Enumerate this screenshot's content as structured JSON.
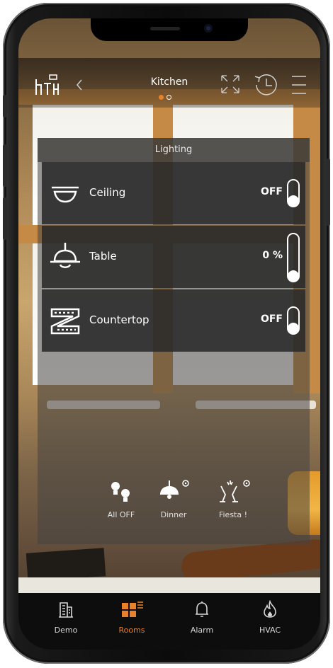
{
  "header": {
    "logo_text": "HTH",
    "room_title": "Kitchen",
    "page_dots": 2,
    "active_dot": 0
  },
  "panel": {
    "title": "Lighting",
    "rows": [
      {
        "label": "Ceiling",
        "value": "OFF",
        "icon": "ceiling-lamp-icon",
        "level": 0
      },
      {
        "label": "Table",
        "value": "0 %",
        "icon": "pendant-lamp-icon",
        "level": 0
      },
      {
        "label": "Countertop",
        "value": "OFF",
        "icon": "led-strip-icon",
        "level": 0
      }
    ],
    "scenes": [
      {
        "label": "All OFF",
        "icon": "bulbs-off-icon"
      },
      {
        "label": "Dinner",
        "icon": "pendant-lamp-icon",
        "settings_icon": "gear-icon"
      },
      {
        "label": "Fiesta !",
        "icon": "champagne-glasses-icon",
        "settings_icon": "gear-icon"
      }
    ]
  },
  "nav": {
    "items": [
      {
        "label": "Demo",
        "icon": "building-icon",
        "active": false
      },
      {
        "label": "Rooms",
        "icon": "rooms-icon",
        "active": true
      },
      {
        "label": "Alarm",
        "icon": "bell-icon",
        "active": false
      },
      {
        "label": "HVAC",
        "icon": "flame-icon",
        "active": false
      }
    ]
  },
  "colors": {
    "accent": "#e8812b",
    "text": "#ffffff",
    "panel_row": "#282828",
    "nav_bg": "#0d0d0d"
  }
}
